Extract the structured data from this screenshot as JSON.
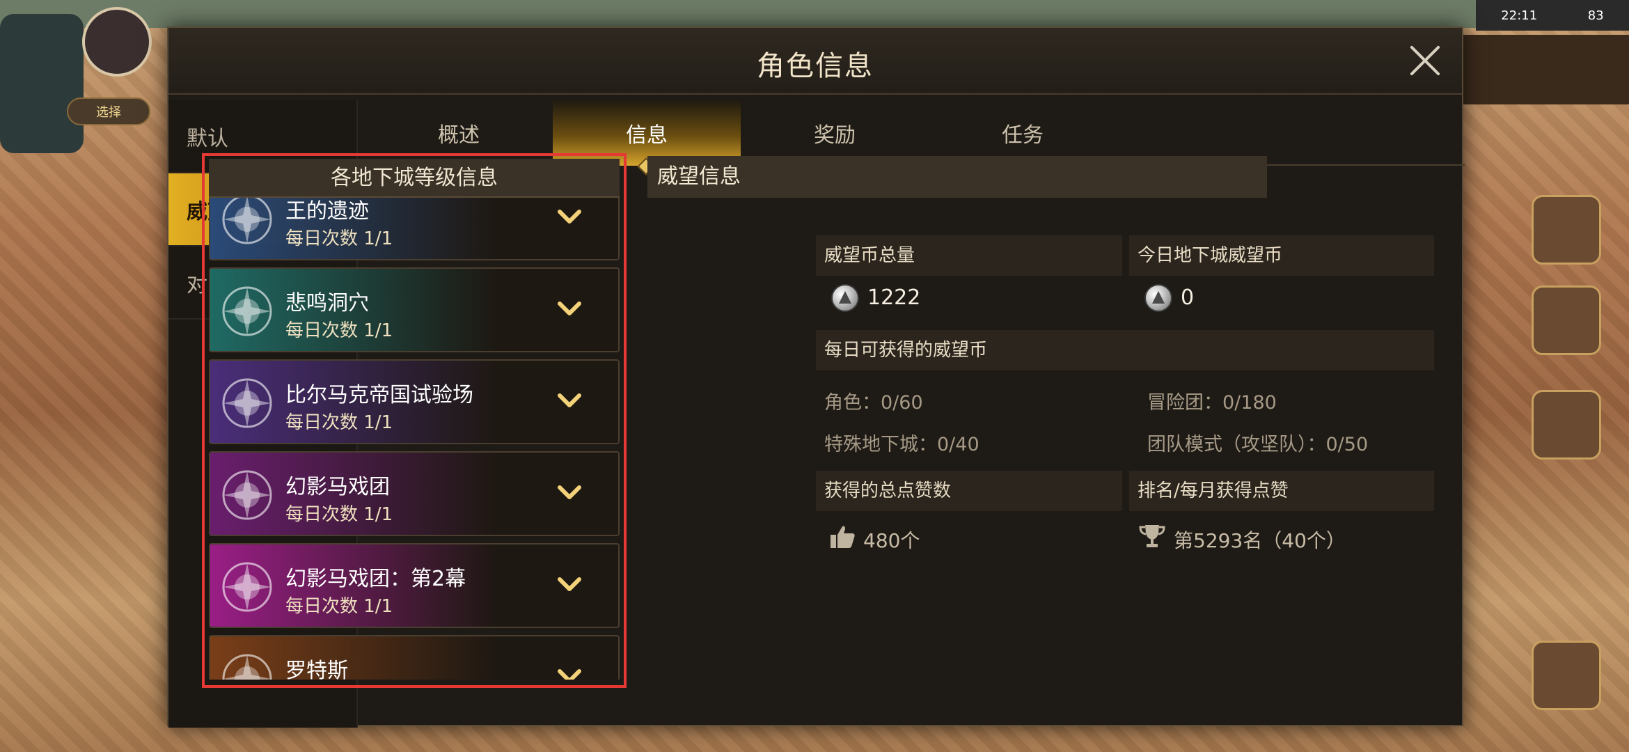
{
  "status_bar": {
    "time": "22:11",
    "battery": "83"
  },
  "background": {
    "left_button": "选择"
  },
  "modal": {
    "title": "角色信息",
    "sidebar": [
      {
        "label": "默认",
        "active": false
      },
      {
        "label": "威望",
        "active": true
      },
      {
        "label": "对战",
        "active": false
      }
    ],
    "tabs": [
      {
        "label": "概述",
        "active": false
      },
      {
        "label": "信息",
        "active": true
      },
      {
        "label": "奖励",
        "active": false
      },
      {
        "label": "任务",
        "active": false
      }
    ]
  },
  "dungeon_panel": {
    "header": "各地下城等级信息",
    "items": [
      {
        "name": "王的遗迹",
        "count": "每日次数 1/1",
        "icon": "crystal-castle-icon",
        "color": "#2a4a78"
      },
      {
        "name": "悲鸣洞穴",
        "count": "每日次数 1/1",
        "icon": "teal-flower-icon",
        "color": "#1f6a64"
      },
      {
        "name": "比尔马克帝国试验场",
        "count": "每日次数 1/1",
        "icon": "demon-face-icon",
        "color": "#4a2e7a"
      },
      {
        "name": "幻影马戏团",
        "count": "每日次数 1/1",
        "icon": "jester-spade-icon",
        "color": "#6a1e6e"
      },
      {
        "name": "幻影马戏团：第2幕",
        "count": "每日次数 1/1",
        "icon": "jester-spade-icon",
        "color": "#9a1e86"
      },
      {
        "name": "罗特斯",
        "count": "",
        "icon": "orange-gear-icon",
        "color": "#7a3e18"
      }
    ]
  },
  "prestige_info": {
    "title": "威望信息",
    "total_coins_label": "威望币总量",
    "total_coins": "1222",
    "today_dungeon_label": "今日地下城威望币",
    "today_dungeon": "0",
    "daily_label": "每日可获得的威望币",
    "daily": {
      "role": "角色：0/60",
      "adventure_team": "冒险团：0/180",
      "special_dungeon": "特殊地下城：0/40",
      "raid_mode": "团队模式（攻坚队）：0/50"
    },
    "likes_label": "获得的总点赞数",
    "likes_value": "480个",
    "rank_label": "排名/每月获得点赞",
    "rank_value": "第5293名（40个）"
  }
}
